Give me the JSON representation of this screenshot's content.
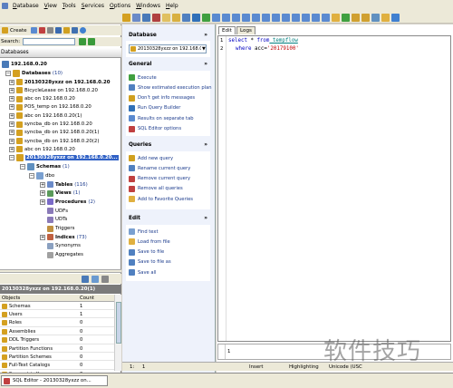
{
  "menu": [
    "Database",
    "View",
    "Tools",
    "Services",
    "Options",
    "Windows",
    "Help"
  ],
  "left": {
    "create_label": "Create",
    "search_label": "Search:",
    "databases_header": "Databases",
    "server": "192.168.0.20",
    "databases_label": "Databases",
    "databases_count": "(10)",
    "db_items": [
      {
        "label": "20130328yxzz on 192.168.0.20",
        "bold": true
      },
      {
        "label": "BicycleLease on 192.168.0.20",
        "bold": false
      },
      {
        "label": "abc on 192.168.0.20",
        "bold": false
      },
      {
        "label": "POS_temp on 192.168.0.20",
        "bold": false
      },
      {
        "label": "abc on 192.168.0.20(1)",
        "bold": false
      },
      {
        "label": "syncba_db on 192.168.0.20",
        "bold": false
      },
      {
        "label": "syncba_db on 192.168.0.20(1)",
        "bold": false
      },
      {
        "label": "syncba_db on 192.168.0.20(2)",
        "bold": false
      },
      {
        "label": "abc on 192.168.0.20",
        "bold": false
      }
    ],
    "selected_db": "20130328yxzz on 192.168.0.20...",
    "schemas_label": "Schemas",
    "schemas_count": "(1)",
    "dbo_label": "dbo",
    "dbo_children": [
      {
        "label": "Tables",
        "count": "(116)",
        "bold": true
      },
      {
        "label": "Views",
        "count": "(1)",
        "bold": true
      },
      {
        "label": "Procedures",
        "count": "(2)",
        "bold": true
      },
      {
        "label": "UDFs",
        "count": "",
        "bold": false
      },
      {
        "label": "UDTs",
        "count": "",
        "bold": false
      },
      {
        "label": "Triggers",
        "count": "",
        "bold": false
      },
      {
        "label": "Indices",
        "count": "(73)",
        "bold": true
      },
      {
        "label": "Synonyms",
        "count": "",
        "bold": false
      },
      {
        "label": "Aggregates",
        "count": "",
        "bold": false
      }
    ],
    "grid_title": "20130328yxzz on 192.168.0.20(1)",
    "grid_headers": [
      "Objects",
      "Count"
    ],
    "grid_rows": [
      {
        "name": "Schemas",
        "count": "1"
      },
      {
        "name": "Users",
        "count": "1"
      },
      {
        "name": "Roles",
        "count": "0"
      },
      {
        "name": "Assemblies",
        "count": "0"
      },
      {
        "name": "DDL Triggers",
        "count": "0"
      },
      {
        "name": "Partition Functions",
        "count": "0"
      },
      {
        "name": "Partition Schemes",
        "count": "0"
      },
      {
        "name": "Full-Text Catalogs",
        "count": "0"
      },
      {
        "name": "Symmetric Keys",
        "count": "0"
      }
    ]
  },
  "middle": {
    "database_title": "Database",
    "database_value": "20130328yxzz on 192.168.0.20",
    "general_title": "General",
    "general_actions": [
      "Execute",
      "Show estimated execution plan",
      "Don't get info messages",
      "Run Query Builder",
      "Results on separate tab",
      "SQL Editor options"
    ],
    "queries_title": "Queries",
    "queries_actions": [
      "Add new query",
      "Rename current query",
      "Remove current query",
      "Remove all queries",
      "Add to Favorite Queries"
    ],
    "edit_title": "Edit",
    "edit_actions": [
      "Find text",
      "Load from file",
      "Save to file",
      "Save to file as",
      "Save all"
    ]
  },
  "editor": {
    "tabs": [
      "Edit",
      "Logs"
    ],
    "line_numbers": [
      "1",
      "2"
    ],
    "line1_kw": "select",
    "line1_op": " * ",
    "line1_kw2": "from",
    "line1_tbl": " tempflow",
    "line2_kw": "where",
    "line2_mid": " acc=",
    "line2_str": "'20179100'",
    "result_line": "1"
  },
  "status": {
    "position": "1:     1",
    "mode": "Insert",
    "highlighting": "Highlighting",
    "encoding": "Unicode (USC"
  },
  "taskbar": {
    "item": "SQL Editor - 20130328yxzz on..."
  },
  "watermark": "软件技巧",
  "colors": {
    "selected": "#3162c6",
    "action_text": "#1a3a8c",
    "panel_bg": "#eef2fb"
  }
}
